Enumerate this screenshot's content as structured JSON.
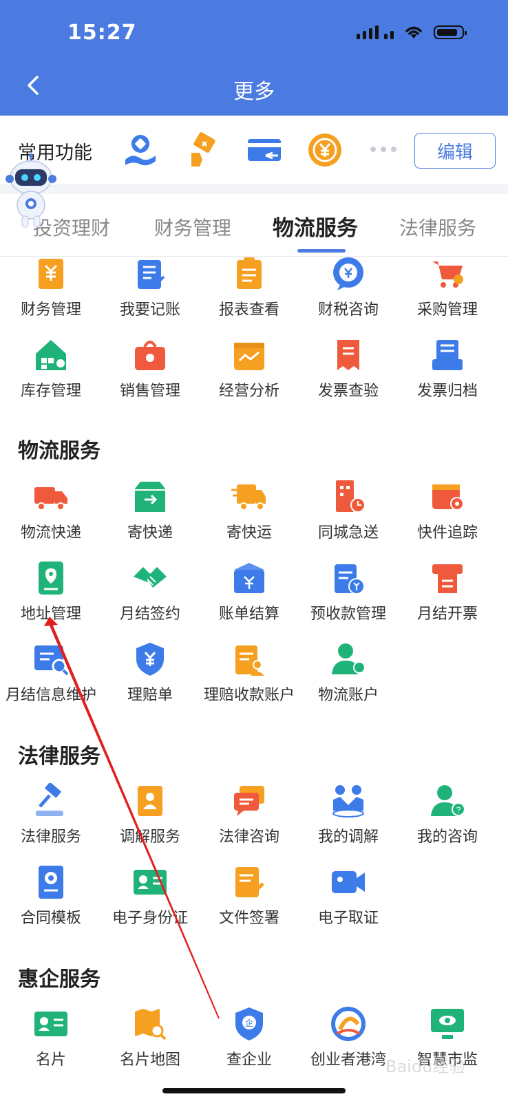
{
  "status_bar": {
    "time": "15:27"
  },
  "header": {
    "title": "更多"
  },
  "common": {
    "label": "常用功能",
    "edit_label": "编辑"
  },
  "tabs": [
    {
      "label": "投资理财"
    },
    {
      "label": "财务管理"
    },
    {
      "label": "物流服务"
    },
    {
      "label": "法律服务"
    }
  ],
  "finance_items": [
    {
      "label": "财务管理"
    },
    {
      "label": "我要记账"
    },
    {
      "label": "报表查看"
    },
    {
      "label": "财税咨询"
    },
    {
      "label": "采购管理"
    },
    {
      "label": "库存管理"
    },
    {
      "label": "销售管理"
    },
    {
      "label": "经营分析"
    },
    {
      "label": "发票查验"
    },
    {
      "label": "发票归档"
    }
  ],
  "logistics": {
    "title": "物流服务",
    "items": [
      {
        "label": "物流快递"
      },
      {
        "label": "寄快递"
      },
      {
        "label": "寄快运"
      },
      {
        "label": "同城急送"
      },
      {
        "label": "快件追踪"
      },
      {
        "label": "地址管理"
      },
      {
        "label": "月结签约"
      },
      {
        "label": "账单结算"
      },
      {
        "label": "预收款管理"
      },
      {
        "label": "月结开票"
      },
      {
        "label": "月结信息维护"
      },
      {
        "label": "理赔单"
      },
      {
        "label": "理赔收款账户"
      },
      {
        "label": "物流账户"
      }
    ]
  },
  "legal": {
    "title": "法律服务",
    "items": [
      {
        "label": "法律服务"
      },
      {
        "label": "调解服务"
      },
      {
        "label": "法律咨询"
      },
      {
        "label": "我的调解"
      },
      {
        "label": "我的咨询"
      },
      {
        "label": "合同模板"
      },
      {
        "label": "电子身份证"
      },
      {
        "label": "文件签署"
      },
      {
        "label": "电子取证"
      }
    ]
  },
  "benefit": {
    "title": "惠企服务",
    "items": [
      {
        "label": "名片"
      },
      {
        "label": "名片地图"
      },
      {
        "label": "查企业"
      },
      {
        "label": "创业者港湾"
      },
      {
        "label": "智慧市监"
      }
    ]
  },
  "watermark": "Baidu经验",
  "colors": {
    "primary": "#4b7be0",
    "orange": "#f5a020",
    "red": "#f05a3c",
    "green": "#1fb37a",
    "blue": "#3d7be8"
  }
}
